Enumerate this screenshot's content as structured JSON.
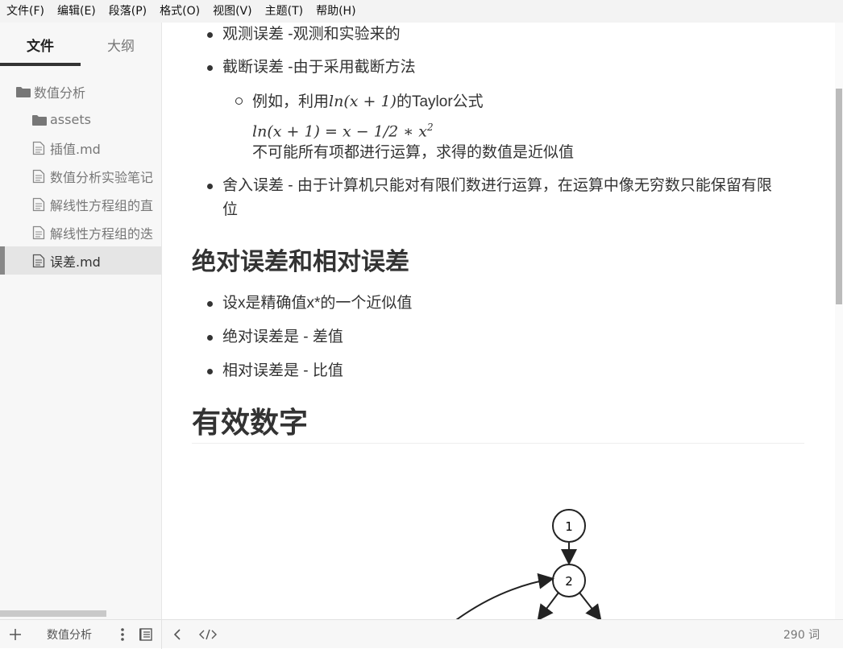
{
  "menu": [
    "文件(F)",
    "编辑(E)",
    "段落(P)",
    "格式(O)",
    "视图(V)",
    "主题(T)",
    "帮助(H)"
  ],
  "sidebar": {
    "tabs": [
      "文件",
      "大纲"
    ],
    "tree": [
      {
        "label": "数值分析",
        "icon": "folder-icon"
      },
      {
        "label": "assets",
        "icon": "folder-icon"
      },
      {
        "label": "插值.md",
        "icon": "file-icon"
      },
      {
        "label": "数值分析实验笔记",
        "icon": "file-icon"
      },
      {
        "label": "解线性方程组的直",
        "icon": "file-icon"
      },
      {
        "label": "解线性方程组的迭",
        "icon": "file-icon"
      },
      {
        "label": "误差.md",
        "icon": "file-icon"
      }
    ]
  },
  "doc": {
    "b1": "观测误差 -观测和实验来的",
    "b2": "截断误差 -由于采用截断方法",
    "sub_prefix": "例如，利用",
    "sub_math": "ln(x + 1)",
    "sub_suffix": "的Taylor公式",
    "formula_lhs": "ln(x + 1) = x − 1/2 ∗ x",
    "formula_exp": "2",
    "sub_note": "不可能所有项都进行运算，求得的数值是近似值",
    "b3_line1": "舍入误差 - 由于计算机只能对有限们数进行运算，在运算中像无穷数只能保留有限",
    "b3_line2": "位",
    "h_abs": "绝对误差和相对误差",
    "c1": "设x是精确值x*的一个近似值",
    "c2": "绝对误差是 - 差值",
    "c3": "相对误差是 - 比值",
    "h_sig": "有效数字",
    "graph": {
      "node1": "1",
      "node2": "2"
    }
  },
  "footer": {
    "add_icon": "plus-icon",
    "folder": "数值分析",
    "words": "290 词"
  }
}
